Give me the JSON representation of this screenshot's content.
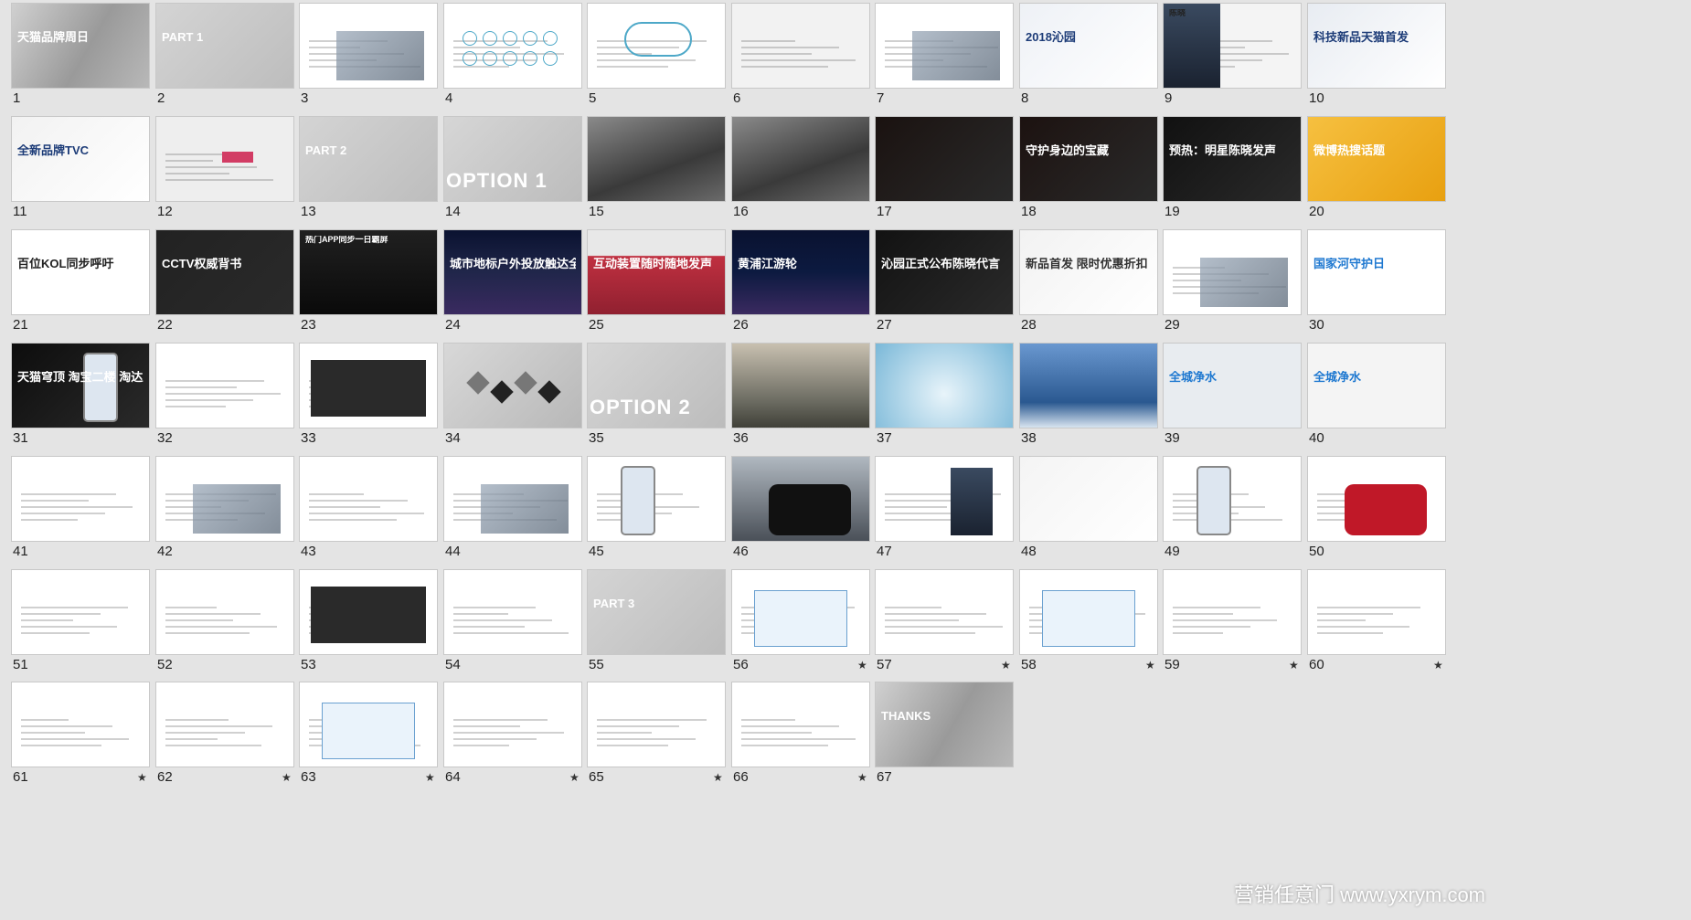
{
  "slides": [
    {
      "n": "1",
      "title": "天猫品牌周日",
      "style": "photo",
      "bg": "#a9a9a9",
      "fg": "#ffffff",
      "star": false
    },
    {
      "n": "2",
      "title": "PART 1",
      "style": "gray",
      "bg": "#c8c8c8",
      "fg": "#ffffff",
      "star": false
    },
    {
      "n": "3",
      "title": "",
      "style": "products",
      "bg": "#ffffff",
      "fg": "#333333",
      "star": false
    },
    {
      "n": "4",
      "title": "",
      "style": "icons",
      "bg": "#ffffff",
      "fg": "#333333",
      "star": false
    },
    {
      "n": "5",
      "title": "",
      "style": "infinity",
      "bg": "#ffffff",
      "fg": "#333333",
      "star": false
    },
    {
      "n": "6",
      "title": "",
      "style": "water",
      "bg": "#f2f2f2",
      "fg": "#333333",
      "star": false
    },
    {
      "n": "7",
      "title": "",
      "style": "collage",
      "bg": "#ffffff",
      "fg": "#333333",
      "star": false
    },
    {
      "n": "8",
      "title": "2018沁园",
      "style": "light",
      "bg": "#eef1f6",
      "fg": "#1d3c78",
      "star": false
    },
    {
      "n": "9",
      "title": "陈晓",
      "style": "portrait",
      "bg": "#f4f4f4",
      "fg": "#222222",
      "star": false
    },
    {
      "n": "10",
      "title": "科技新品天猫首发",
      "style": "light",
      "bg": "#e8ecf2",
      "fg": "#1d3c78",
      "star": false
    },
    {
      "n": "11",
      "title": "全新品牌TVC",
      "style": "light",
      "bg": "#f2f2f2",
      "fg": "#1d3c78",
      "star": false
    },
    {
      "n": "12",
      "title": "",
      "style": "logos",
      "bg": "#eeeeee",
      "fg": "#d23c64",
      "star": false
    },
    {
      "n": "13",
      "title": "PART 2",
      "style": "gray",
      "bg": "#c8c8c8",
      "fg": "#ffffff",
      "star": false
    },
    {
      "n": "14",
      "title": "OPTION 1",
      "style": "option",
      "bg": "#c9c9c9",
      "fg": "#ffffff",
      "star": false
    },
    {
      "n": "15",
      "title": "",
      "style": "dark-photo",
      "bg": "#5a5a5a",
      "fg": "#ffffff",
      "star": false
    },
    {
      "n": "16",
      "title": "",
      "style": "dark-photo",
      "bg": "#4a4a4a",
      "fg": "#ffffff",
      "star": false
    },
    {
      "n": "17",
      "title": "",
      "style": "black",
      "bg": "#1a1210",
      "fg": "#ffcc66",
      "star": false
    },
    {
      "n": "18",
      "title": "守护身边的宝藏",
      "style": "black",
      "bg": "#1c1210",
      "fg": "#ffffff",
      "star": false
    },
    {
      "n": "19",
      "title": "预热：明星陈晓发声",
      "style": "black",
      "bg": "#111111",
      "fg": "#ffffff",
      "star": false
    },
    {
      "n": "20",
      "title": "微博热搜话题",
      "style": "yellow",
      "bg": "#f0b020",
      "fg": "#ffffff",
      "star": false
    },
    {
      "n": "21",
      "title": "百位KOL同步呼吁",
      "style": "light",
      "bg": "#ffffff",
      "fg": "#222222",
      "star": false
    },
    {
      "n": "22",
      "title": "CCTV权威背书",
      "style": "black",
      "bg": "#222222",
      "fg": "#ffffff",
      "star": false
    },
    {
      "n": "23",
      "title": "热门APP同步一日霸屏",
      "style": "phones",
      "bg": "#151515",
      "fg": "#ffffff",
      "star": false
    },
    {
      "n": "24",
      "title": "城市地标户外投放触达全民",
      "style": "city",
      "bg": "#20264a",
      "fg": "#ffffff",
      "star": false
    },
    {
      "n": "25",
      "title": "互动装置随时随地发声",
      "style": "red",
      "bg": "#c03040",
      "fg": "#ffffff",
      "star": false
    },
    {
      "n": "26",
      "title": "黄浦江游轮",
      "style": "night",
      "bg": "#0c1a40",
      "fg": "#ffffff",
      "star": false
    },
    {
      "n": "27",
      "title": "沁园正式公布陈晓代言",
      "style": "black",
      "bg": "#121212",
      "fg": "#ffffff",
      "star": false
    },
    {
      "n": "28",
      "title": "新品首发 限时优惠折扣",
      "style": "light",
      "bg": "#f2f2f2",
      "fg": "#333333",
      "star": false
    },
    {
      "n": "29",
      "title": "",
      "style": "gift",
      "bg": "#ffffff",
      "fg": "#333333",
      "star": false
    },
    {
      "n": "30",
      "title": "国家河守护日",
      "style": "blue-logo",
      "bg": "#ffffff",
      "fg": "#1e78d0",
      "star": false
    },
    {
      "n": "31",
      "title": "天猫穹顶 淘宝二楼 淘达人",
      "style": "phone-black",
      "bg": "#0d0d0d",
      "fg": "#ffffff",
      "star": false
    },
    {
      "n": "32",
      "title": "",
      "style": "doc",
      "bg": "#ffffff",
      "fg": "#333333",
      "star": false
    },
    {
      "n": "33",
      "title": "",
      "style": "table-dark",
      "bg": "#ffffff",
      "fg": "#333333",
      "star": false
    },
    {
      "n": "34",
      "title": "",
      "style": "diamonds",
      "bg": "#cccccc",
      "fg": "#ffffff",
      "star": false
    },
    {
      "n": "35",
      "title": "OPTION 2",
      "style": "option",
      "bg": "#c9c9c9",
      "fg": "#ffffff",
      "star": false
    },
    {
      "n": "36",
      "title": "",
      "style": "sunset",
      "bg": "#8a8a80",
      "fg": "#ffffff",
      "star": false
    },
    {
      "n": "37",
      "title": "",
      "style": "splash",
      "bg": "#aed4e8",
      "fg": "#ffffff",
      "star": false
    },
    {
      "n": "38",
      "title": "",
      "style": "glass",
      "bg": "#4a78b0",
      "fg": "#ffffff",
      "star": false
    },
    {
      "n": "39",
      "title": "全城净水",
      "style": "blue-logo",
      "bg": "#e8ecf0",
      "fg": "#1e78d0",
      "star": false
    },
    {
      "n": "40",
      "title": "全城净水",
      "style": "blue-logo",
      "bg": "#f4f4f4",
      "fg": "#1e78d0",
      "star": false
    },
    {
      "n": "41",
      "title": "",
      "style": "doc",
      "bg": "#ffffff",
      "fg": "#333333",
      "star": false
    },
    {
      "n": "42",
      "title": "",
      "style": "city-grid",
      "bg": "#ffffff",
      "fg": "#333333",
      "star": false
    },
    {
      "n": "43",
      "title": "",
      "style": "doc",
      "bg": "#ffffff",
      "fg": "#333333",
      "star": false
    },
    {
      "n": "44",
      "title": "",
      "style": "apps",
      "bg": "#ffffff",
      "fg": "#333333",
      "star": false
    },
    {
      "n": "45",
      "title": "",
      "style": "phone-white",
      "bg": "#ffffff",
      "fg": "#333333",
      "star": false
    },
    {
      "n": "46",
      "title": "",
      "style": "cat",
      "bg": "#5a6470",
      "fg": "#ffffff",
      "star": false
    },
    {
      "n": "47",
      "title": "",
      "style": "portrait-white",
      "bg": "#ffffff",
      "fg": "#333333",
      "star": false
    },
    {
      "n": "48",
      "title": "",
      "style": "light",
      "bg": "#f4f4f4",
      "fg": "#333333",
      "star": false
    },
    {
      "n": "49",
      "title": "",
      "style": "phone-white",
      "bg": "#ffffff",
      "fg": "#333333",
      "star": false
    },
    {
      "n": "50",
      "title": "",
      "style": "cat-red",
      "bg": "#ffffff",
      "fg": "#333333",
      "star": false
    },
    {
      "n": "51",
      "title": "",
      "style": "doc",
      "bg": "#ffffff",
      "fg": "#333333",
      "star": false
    },
    {
      "n": "52",
      "title": "",
      "style": "doc",
      "bg": "#ffffff",
      "fg": "#333333",
      "star": false
    },
    {
      "n": "53",
      "title": "",
      "style": "table-dark",
      "bg": "#ffffff",
      "fg": "#333333",
      "star": false
    },
    {
      "n": "54",
      "title": "",
      "style": "doc",
      "bg": "#ffffff",
      "fg": "#333333",
      "star": false
    },
    {
      "n": "55",
      "title": "PART 3",
      "style": "gray",
      "bg": "#c8c8c8",
      "fg": "#ffffff",
      "star": false
    },
    {
      "n": "56",
      "title": "",
      "style": "flow",
      "bg": "#ffffff",
      "fg": "#333333",
      "star": true
    },
    {
      "n": "57",
      "title": "",
      "style": "doc",
      "bg": "#ffffff",
      "fg": "#333333",
      "star": true
    },
    {
      "n": "58",
      "title": "",
      "style": "flow",
      "bg": "#ffffff",
      "fg": "#333333",
      "star": true
    },
    {
      "n": "59",
      "title": "",
      "style": "doc",
      "bg": "#ffffff",
      "fg": "#333333",
      "star": true
    },
    {
      "n": "60",
      "title": "",
      "style": "doc",
      "bg": "#ffffff",
      "fg": "#333333",
      "star": true
    },
    {
      "n": "61",
      "title": "",
      "style": "doc",
      "bg": "#ffffff",
      "fg": "#333333",
      "star": true
    },
    {
      "n": "62",
      "title": "",
      "style": "doc",
      "bg": "#ffffff",
      "fg": "#333333",
      "star": true
    },
    {
      "n": "63",
      "title": "",
      "style": "map",
      "bg": "#ffffff",
      "fg": "#333333",
      "star": true
    },
    {
      "n": "64",
      "title": "",
      "style": "doc",
      "bg": "#ffffff",
      "fg": "#333333",
      "star": true
    },
    {
      "n": "65",
      "title": "",
      "style": "doc",
      "bg": "#ffffff",
      "fg": "#333333",
      "star": true
    },
    {
      "n": "66",
      "title": "",
      "style": "doc",
      "bg": "#ffffff",
      "fg": "#333333",
      "star": true
    },
    {
      "n": "67",
      "title": "THANKS",
      "style": "photo",
      "bg": "#a9a9a9",
      "fg": "#ffffff",
      "star": false
    }
  ],
  "star_glyph": "★",
  "watermark": "营销任意门 www.yxrym.com"
}
